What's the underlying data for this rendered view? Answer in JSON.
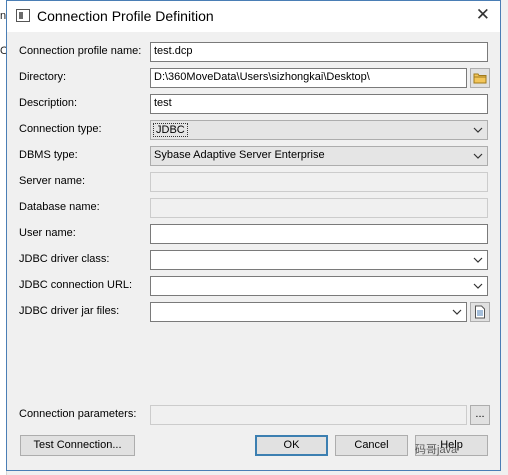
{
  "background": {
    "edge_letters": [
      "n",
      "O"
    ]
  },
  "dialog": {
    "title": "Connection Profile Definition",
    "close_glyph": "✕"
  },
  "form": {
    "profile_name_label": "Connection profile name:",
    "profile_name_value": "test.dcp",
    "directory_label": "Directory:",
    "directory_value": "D:\\360MoveData\\Users\\sizhongkai\\Desktop\\",
    "description_label": "Description:",
    "description_value": "test",
    "connection_type_label": "Connection type:",
    "connection_type_value": "JDBC",
    "dbms_type_label": "DBMS type:",
    "dbms_type_value": "Sybase Adaptive Server Enterprise",
    "server_name_label": "Server name:",
    "server_name_value": "",
    "database_name_label": "Database name:",
    "database_name_value": "",
    "user_name_label": "User name:",
    "user_name_value": "",
    "driver_class_label": "JDBC driver class:",
    "driver_class_value": "",
    "connection_url_label": "JDBC connection URL:",
    "connection_url_value": "",
    "jar_files_label": "JDBC driver jar files:",
    "jar_files_value": "",
    "connection_params_label": "Connection parameters:",
    "connection_params_value": "",
    "ellipsis_label": "..."
  },
  "buttons": {
    "test_connection": "Test Connection...",
    "ok": "OK",
    "cancel": "Cancel",
    "help": "Help"
  },
  "watermark": {
    "text": "码哥java"
  }
}
